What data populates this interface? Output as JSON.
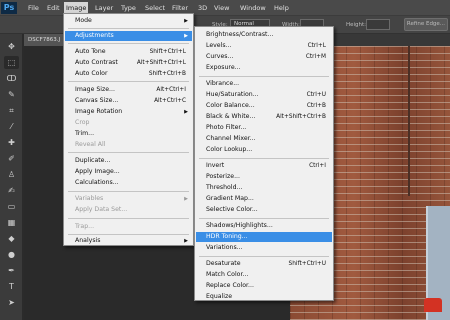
{
  "app": {
    "logo": "Ps"
  },
  "menubar": {
    "items": [
      "File",
      "Edit",
      "Image",
      "Layer",
      "Type",
      "Select",
      "Filter",
      "3D",
      "View",
      "Window",
      "Help"
    ],
    "active": "Image"
  },
  "options": {
    "style_label": "Style:",
    "style_value": "Normal",
    "width_label": "Width:",
    "height_label": "Height:",
    "refine_edge": "Refine Edge..."
  },
  "document": {
    "tab": "DSCF7863.J"
  },
  "image_menu": {
    "mode": "Mode",
    "adjustments": "Adjustments",
    "auto_tone": "Auto Tone",
    "auto_tone_sc": "Shift+Ctrl+L",
    "auto_contrast": "Auto Contrast",
    "auto_contrast_sc": "Alt+Shift+Ctrl+L",
    "auto_color": "Auto Color",
    "auto_color_sc": "Shift+Ctrl+B",
    "image_size": "Image Size...",
    "image_size_sc": "Alt+Ctrl+I",
    "canvas_size": "Canvas Size...",
    "canvas_size_sc": "Alt+Ctrl+C",
    "image_rotation": "Image Rotation",
    "crop": "Crop",
    "trim": "Trim...",
    "reveal_all": "Reveal All",
    "duplicate": "Duplicate...",
    "apply_image": "Apply Image...",
    "calculations": "Calculations...",
    "variables": "Variables",
    "apply_data_set": "Apply Data Set...",
    "trap": "Trap...",
    "analysis": "Analysis"
  },
  "adjust_menu": {
    "brightness_contrast": "Brightness/Contrast...",
    "levels": "Levels...",
    "levels_sc": "Ctrl+L",
    "curves": "Curves...",
    "curves_sc": "Ctrl+M",
    "exposure": "Exposure...",
    "vibrance": "Vibrance...",
    "hue_saturation": "Hue/Saturation...",
    "hue_saturation_sc": "Ctrl+U",
    "color_balance": "Color Balance...",
    "color_balance_sc": "Ctrl+B",
    "black_white": "Black & White...",
    "black_white_sc": "Alt+Shift+Ctrl+B",
    "photo_filter": "Photo Filter...",
    "channel_mixer": "Channel Mixer...",
    "color_lookup": "Color Lookup...",
    "invert": "Invert",
    "invert_sc": "Ctrl+I",
    "posterize": "Posterize...",
    "threshold": "Threshold...",
    "gradient_map": "Gradient Map...",
    "selective_color": "Selective Color...",
    "shadows_highlights": "Shadows/Highlights...",
    "hdr_toning": "HDR Toning...",
    "variations": "Variations...",
    "desaturate": "Desaturate",
    "desaturate_sc": "Shift+Ctrl+U",
    "match_color": "Match Color...",
    "replace_color": "Replace Color...",
    "equalize": "Equalize"
  },
  "colors": {
    "highlight": "#3a8ee6",
    "menubar": "#4a4a4a",
    "logo_bg": "#0e2a45",
    "logo_fg": "#4fa8f0"
  }
}
